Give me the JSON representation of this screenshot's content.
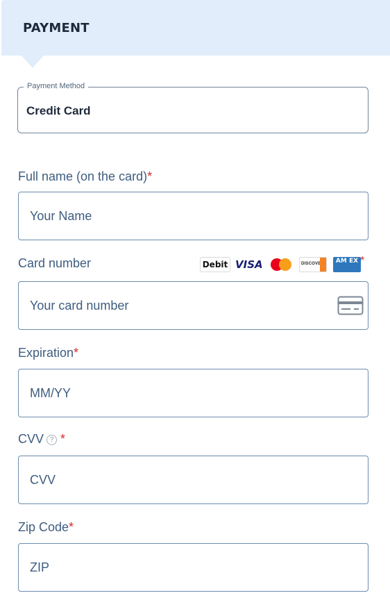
{
  "header": {
    "title": "PAYMENT"
  },
  "payment_method": {
    "legend": "Payment Method",
    "value": "Credit Card"
  },
  "full_name": {
    "label": "Full name (on the card)",
    "required": "*",
    "placeholder": "Your Name"
  },
  "card_number": {
    "label": "Card number",
    "required": "*",
    "placeholder": "Your card number",
    "accepted_cards": {
      "debit": "Debit",
      "visa": "VISA",
      "mastercard": "",
      "discover": "DISCOVER",
      "amex": "AM EX"
    }
  },
  "expiration": {
    "label": "Expiration",
    "required": "*",
    "placeholder": "MM/YY"
  },
  "cvv": {
    "label": "CVV",
    "help": "?",
    "required": "*",
    "placeholder": "CVV"
  },
  "zip": {
    "label": "Zip Code",
    "required": "*",
    "placeholder": "ZIP"
  },
  "colors": {
    "header_bg": "#e1edfb",
    "label": "#3e5d80",
    "required": "#d12c2c",
    "field_border": "#6b8cae"
  }
}
